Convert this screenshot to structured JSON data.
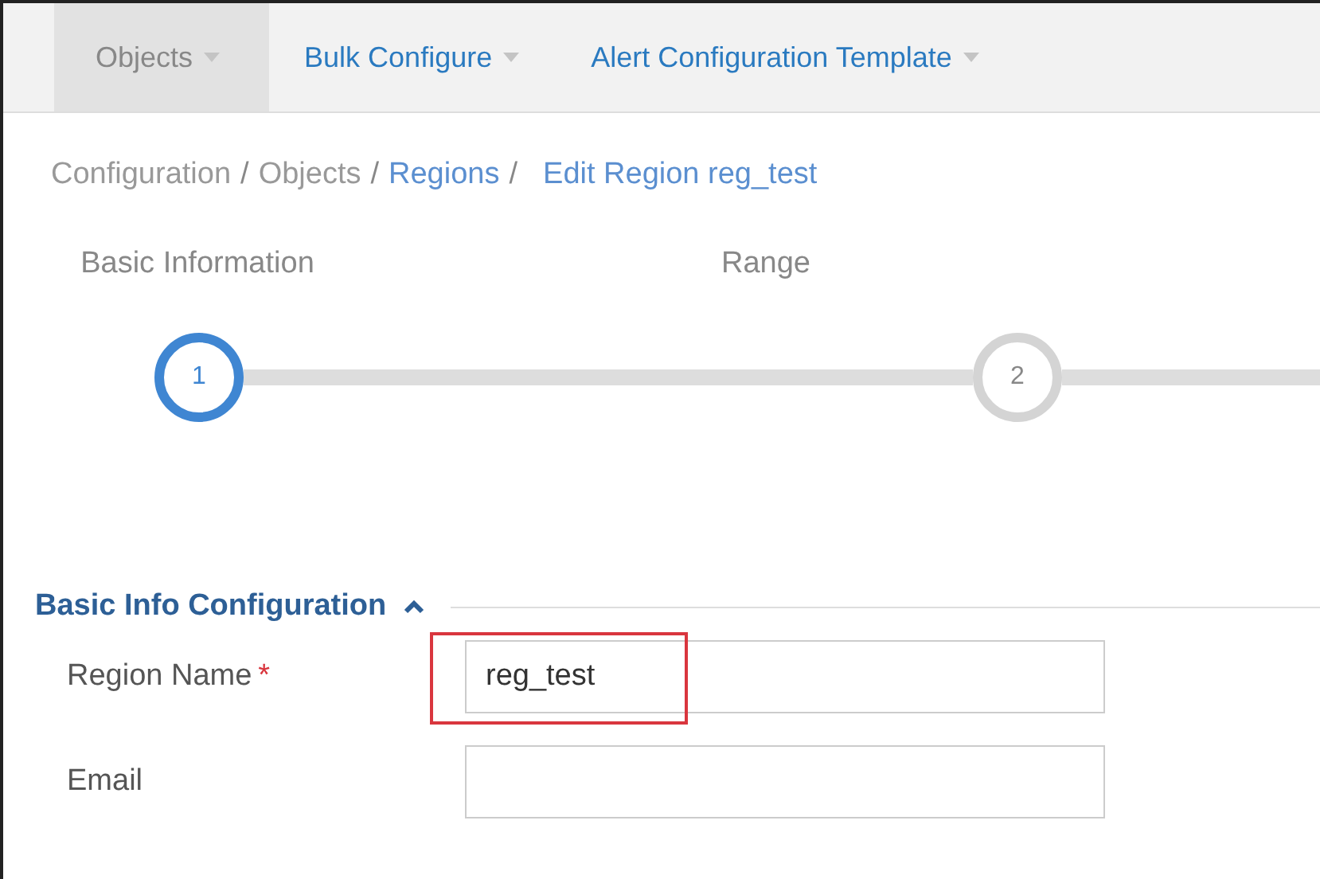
{
  "nav_tabs": [
    {
      "label": "Objects",
      "selected": true
    },
    {
      "label": "Bulk Configure",
      "selected": false
    },
    {
      "label": "Alert Configuration Template",
      "selected": false
    }
  ],
  "breadcrumb": [
    {
      "text": "Configuration",
      "kind": "plain"
    },
    {
      "text": "/",
      "kind": "separator"
    },
    {
      "text": "Objects",
      "kind": "plain"
    },
    {
      "text": "/",
      "kind": "separator"
    },
    {
      "text": "Regions",
      "kind": "link"
    },
    {
      "text": "/",
      "kind": "separator"
    },
    {
      "text": "Edit Region reg_test",
      "kind": "current"
    }
  ],
  "steps": [
    {
      "label": "Basic Information",
      "number": "1",
      "selected": true
    },
    {
      "label": "Range",
      "number": "2",
      "selected": false
    }
  ],
  "section": {
    "title": "Basic Info Configuration",
    "expanded": true
  },
  "fields": [
    {
      "label": "Region Name",
      "required_mark": "*",
      "value": "reg_test",
      "highlighted": true
    },
    {
      "label": "Email",
      "highlighted": false
    }
  ]
}
